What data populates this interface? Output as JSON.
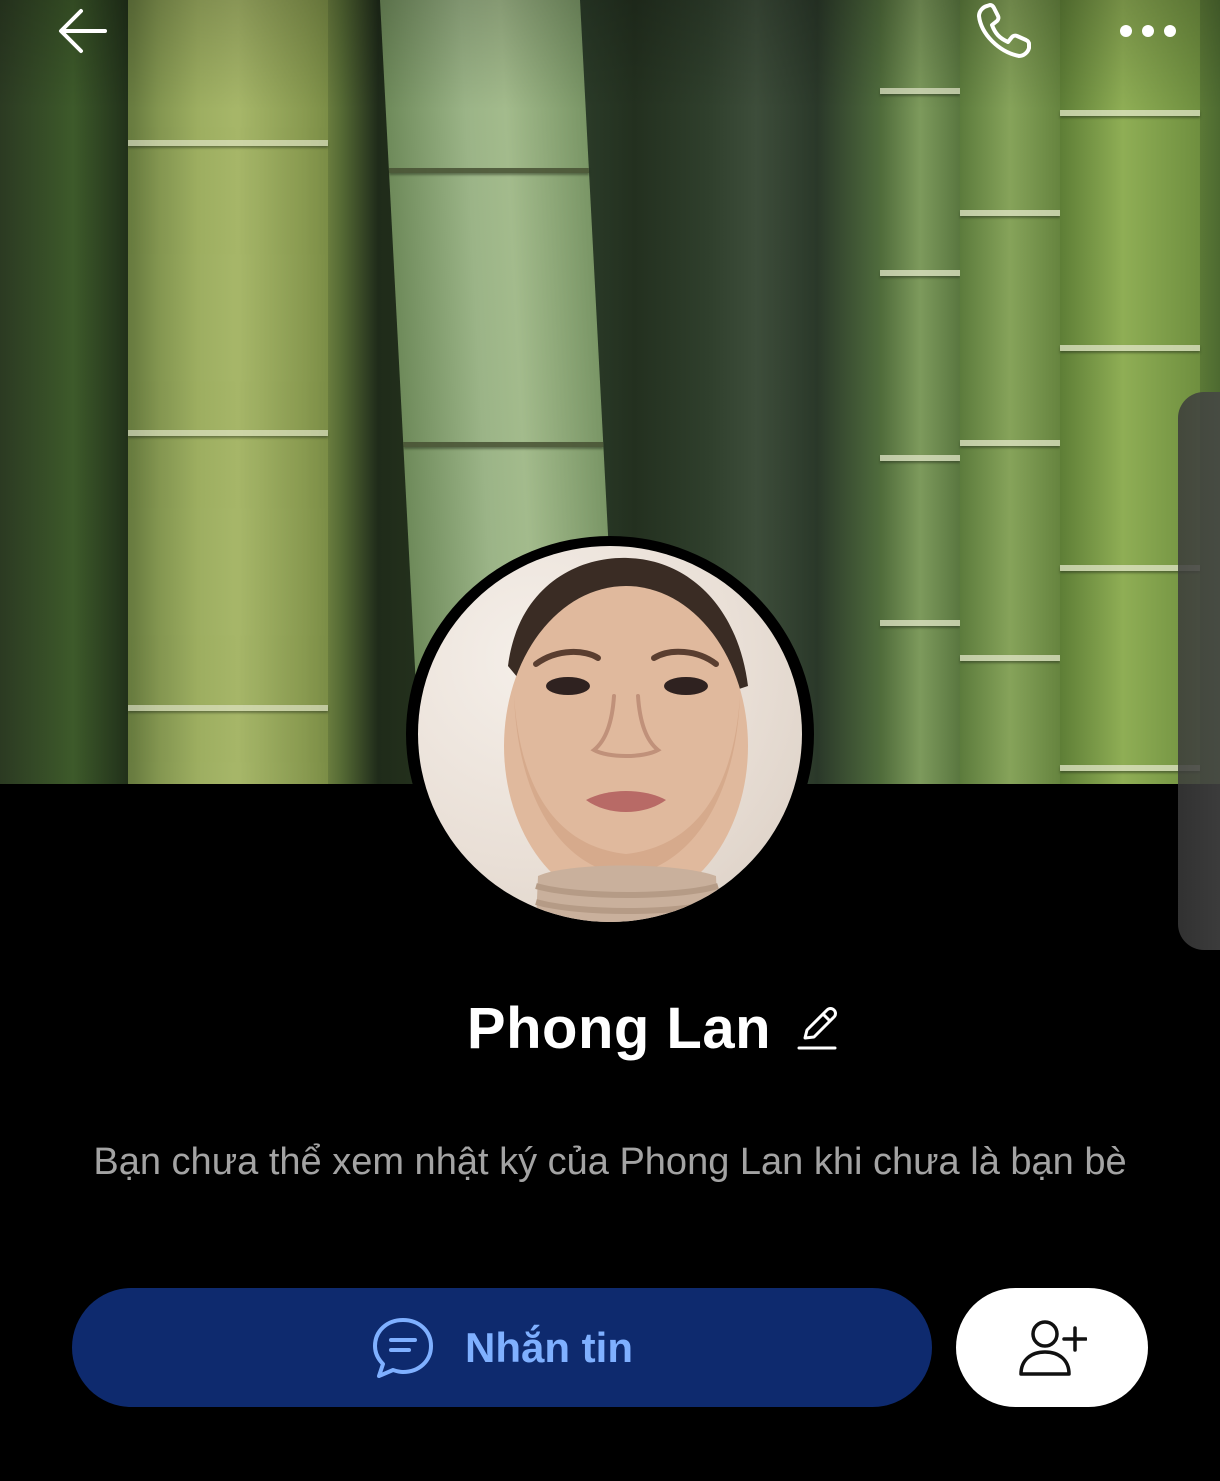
{
  "profile": {
    "name": "Phong Lan",
    "notice": "Bạn chưa thể xem nhật ký của Phong Lan khi chưa là bạn bè"
  },
  "actions": {
    "message_label": "Nhắn tin"
  },
  "icons": {
    "back": "arrow-left-icon",
    "call": "phone-icon",
    "more": "more-horizontal-icon",
    "edit": "pencil-icon",
    "message": "chat-bubble-icon",
    "add_friend": "add-user-icon"
  },
  "colors": {
    "background": "#000000",
    "message_button": "#0e2a6e",
    "message_label": "#7fb0ff",
    "add_button": "#ffffff",
    "notice_text": "#a3a3a3"
  }
}
